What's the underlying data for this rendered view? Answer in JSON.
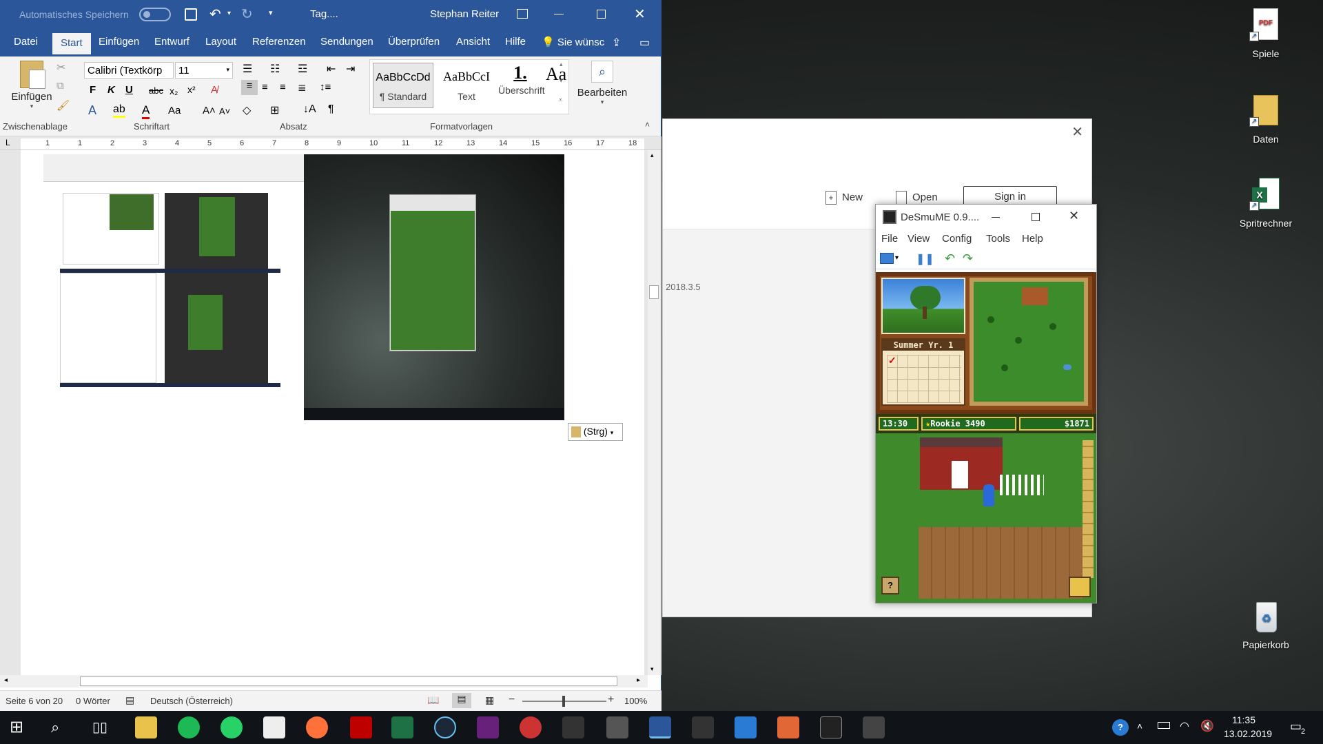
{
  "desktop": {
    "icons": [
      {
        "label": "Spiele"
      },
      {
        "label": "Daten"
      },
      {
        "label": "Spritrechner"
      },
      {
        "label": "Papierkorb"
      }
    ]
  },
  "bg_dialog": {
    "new_label": "New",
    "open_label": "Open",
    "signin_label": "Sign in",
    "version": "2018.3.5"
  },
  "word": {
    "autosave_label": "Automatisches Speichern",
    "title": "Tag....",
    "user": "Stephan Reiter",
    "tabs": [
      "Datei",
      "Start",
      "Einfügen",
      "Entwurf",
      "Layout",
      "Referenzen",
      "Sendungen",
      "Überprüfen",
      "Ansicht",
      "Hilfe"
    ],
    "tell_me": "Sie wünsc",
    "ribbon": {
      "paste_label": "Einfügen",
      "font_name": "Calibri (Textkörp",
      "font_size": "11",
      "styles": [
        {
          "preview": "AaBbCcDd",
          "name": "¶ Standard"
        },
        {
          "preview": "AaBbCcI",
          "name": "Text"
        },
        {
          "preview": "1.",
          "name": "Überschrift"
        },
        {
          "preview": "Aa",
          "name": ""
        }
      ],
      "edit_label": "Bearbeiten",
      "groups": [
        "Zwischenablage",
        "Schriftart",
        "Absatz",
        "Formatvorlagen"
      ]
    },
    "ruler_numbers": [
      "1",
      "1",
      "2",
      "3",
      "4",
      "5",
      "6",
      "7",
      "8",
      "9",
      "10",
      "11",
      "12",
      "13",
      "14",
      "15",
      "16",
      "17",
      "18"
    ],
    "paste_options": "(Strg)",
    "status": {
      "page": "Seite 6 von 20",
      "words": "0 Wörter",
      "language": "Deutsch (Österreich)",
      "zoom": "100%"
    }
  },
  "desmume": {
    "title": "DeSmuME 0.9....",
    "menu": [
      "File",
      "View",
      "Config",
      "Tools",
      "Help"
    ],
    "game": {
      "season": "Summer Yr. 1",
      "time": "13:30",
      "rank": "Rookie 3490",
      "money": "$1871"
    }
  },
  "taskbar": {
    "time": "11:35",
    "date": "13.02.2019",
    "notifications": "2"
  },
  "colors": {
    "word_blue": "#2b579a",
    "ribbon_bg": "#f3f3f3",
    "taskbar": "#101418",
    "game_green": "#2f6e1f"
  }
}
